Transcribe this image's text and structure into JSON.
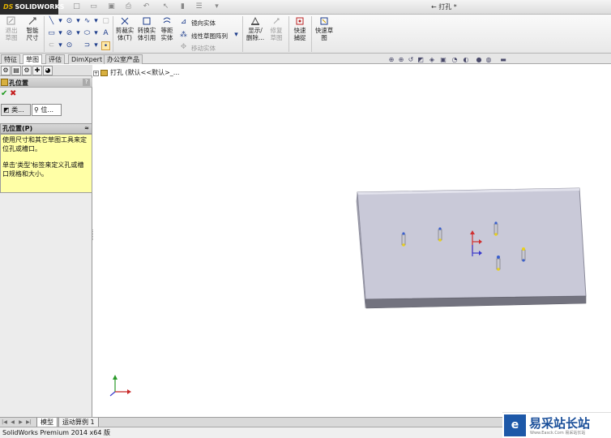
{
  "app": {
    "logo_text": "SOLIDWORKS",
    "logo_ds": "DS",
    "document_title": "← 打孔 *"
  },
  "toolbar": {
    "exit_sketch": "退出草图",
    "smart_dimension": "智能尺寸",
    "trim_entities": "剪裁实体(T)",
    "convert_entities": "转换实体引用",
    "offset_entities": "等距实体",
    "mirror_entities": "镜向实体",
    "linear_pattern": "线性草图阵列",
    "move_entities": "移动实体",
    "display_delete_relations": "显示/删除...",
    "repair_sketch": "修复草图",
    "quick_snaps": "快速捕捉",
    "rapid_sketch": "快速草图"
  },
  "tabs": [
    "特征",
    "草图",
    "评估",
    "DimXpert",
    "办公室产品"
  ],
  "active_tab": "草图",
  "property_manager": {
    "title": "孔位置",
    "help": "?",
    "ok_symbol": "✔",
    "cancel_symbol": "✖",
    "tab_type": "类...",
    "tab_position": "位...",
    "group_title": "孔位置(P)",
    "message_line1": "使用尺寸和其它草图工具来定位孔或槽口。",
    "message_line2": "单击'类型'标签来定义孔或槽口规格和大小。"
  },
  "feature_tree": {
    "label": "打孔 (默认<<默认>_..."
  },
  "bottom_tabs": [
    "模型",
    "运动算例 1"
  ],
  "active_bottom_tab": "模型",
  "status": {
    "text": "SolidWorks Premium 2014 x64 版"
  },
  "watermark": {
    "text": "易采站长站",
    "sub": "Www.Easck.Com  易采站长站",
    "mark": "e"
  },
  "colors": {
    "part_top": "#c9c9d8",
    "part_side": "#73737f",
    "message_bg": "#ffffa6",
    "accent": "#1d58a8"
  }
}
